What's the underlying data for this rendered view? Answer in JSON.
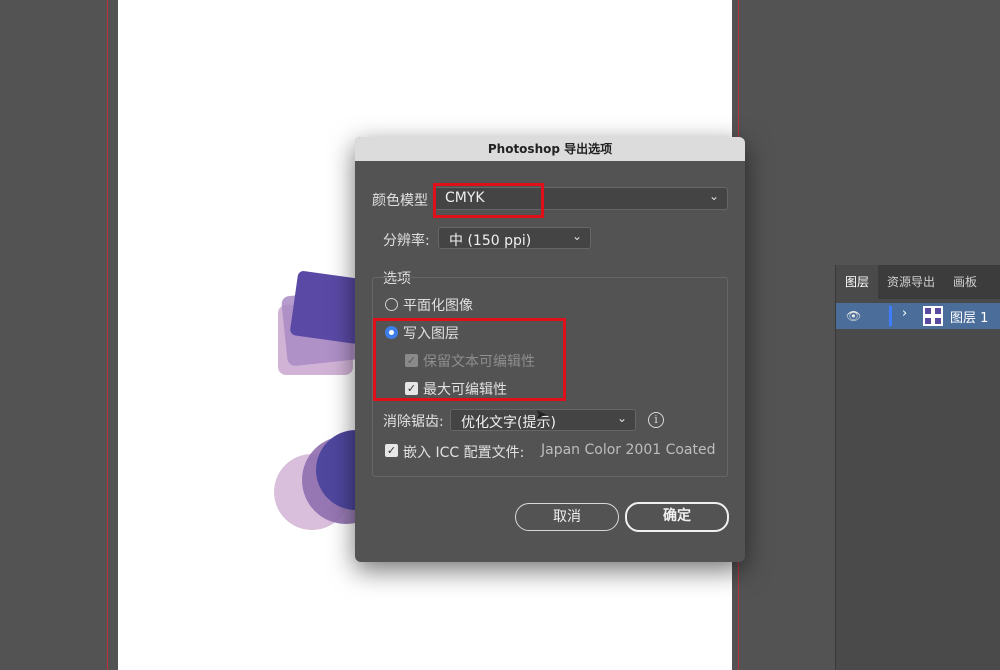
{
  "dialog": {
    "title": "Photoshop 导出选项",
    "color_model_label": "颜色模型",
    "color_model_value": "CMYK",
    "resolution_label": "分辨率:",
    "resolution_value": "中 (150 ppi)",
    "options_group_label": "选项",
    "flatten_label": "平面化图像",
    "write_layers_label": "写入图层",
    "preserve_text_label": "保留文本可编辑性",
    "max_edit_label": "最大可编辑性",
    "antialias_label": "消除锯齿:",
    "antialias_value": "优化文字(提示)",
    "embed_icc_label": "嵌入 ICC 配置文件:",
    "embed_icc_value": "Japan Color 2001 Coated",
    "cancel_label": "取消",
    "ok_label": "确定",
    "selected_option": "write_layers",
    "preserve_text_checked": true,
    "preserve_text_disabled": true,
    "max_edit_checked": true,
    "embed_icc_checked": true
  },
  "panel": {
    "tabs": [
      "图层",
      "资源导出",
      "画板"
    ],
    "layer_name": "图层 1"
  },
  "icons": {
    "chevron": "chevron-down-icon",
    "info": "info-icon",
    "eye": "eye-icon",
    "expand": "chevron-right-icon"
  },
  "colors": {
    "highlight": "#e0101a",
    "radio_accent": "#3d7ee8",
    "layer_selected": "#4a6d99"
  }
}
